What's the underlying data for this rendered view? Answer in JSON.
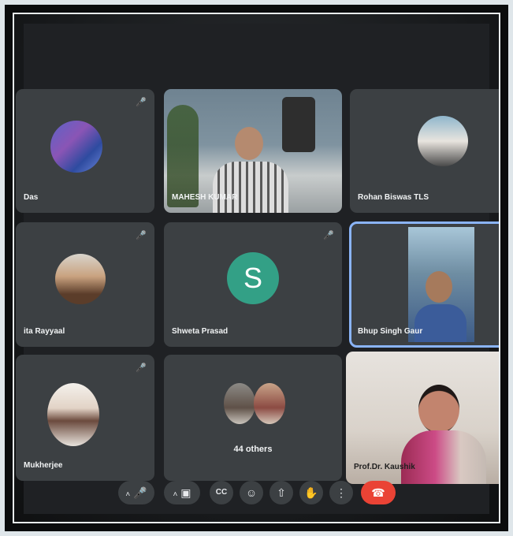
{
  "meeting": {
    "participants": [
      {
        "name": "Das",
        "muted": true
      },
      {
        "name": "MAHESH KUMAR",
        "muted": false
      },
      {
        "name": "Rohan Biswas TLS",
        "muted": false
      },
      {
        "name": "ita Rayyaal",
        "muted": true
      },
      {
        "name": "Shweta Prasad",
        "initial": "S",
        "muted": true
      },
      {
        "name": "Bhup Singh Gaur",
        "muted": false
      },
      {
        "name": "Mukherjee",
        "muted": true
      },
      {
        "name": "44 others",
        "muted": false
      },
      {
        "name": "Prof.Dr. Kaushik",
        "muted": false
      }
    ]
  },
  "toolbar": {
    "icons": {
      "mic": "🎤",
      "camera": "▣",
      "captions": "CC",
      "emoji": "☺",
      "present": "⇧",
      "raise_hand": "✋",
      "more": "⋮",
      "end_call": "☎",
      "caret": "˄"
    }
  },
  "colors": {
    "tile": "#3c4043",
    "active_border": "#8ab4f8",
    "avatar_s": "#33a086",
    "end_call": "#ea4335"
  }
}
